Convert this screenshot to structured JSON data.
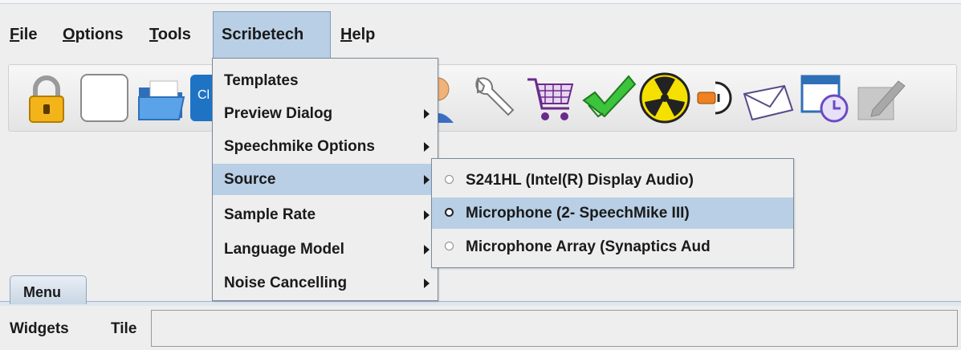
{
  "menubar": {
    "items": [
      {
        "label": "File",
        "mnemonic": "F",
        "rest": "ile"
      },
      {
        "label": "Options",
        "mnemonic": "O",
        "rest": "ptions"
      },
      {
        "label": "Tools",
        "mnemonic": "T",
        "rest": "ools"
      },
      {
        "label": "Scribetech"
      },
      {
        "label": "Help",
        "mnemonic": "H",
        "rest": "elp"
      }
    ]
  },
  "toolbar": {
    "icons": [
      "lock-icon",
      "blank-page-icon",
      "folder-icon",
      "partial-blue-icon",
      "user-icon",
      "wrench-icon",
      "shopping-cart-icon",
      "checkmark-icon",
      "radiation-icon",
      "plug-icon",
      "envelope-icon",
      "window-clock-icon",
      "disabled-edit-icon"
    ],
    "partial_label": "Cl"
  },
  "scribetech_menu": {
    "items": [
      {
        "label": "Templates",
        "submenu": false
      },
      {
        "label": "Preview Dialog",
        "submenu": true
      },
      {
        "label": "Speechmike Options",
        "submenu": true
      },
      {
        "label": "Source",
        "submenu": true,
        "highlighted": true
      },
      {
        "label": "Sample Rate",
        "submenu": true
      },
      {
        "label": "Language Model",
        "submenu": true
      },
      {
        "label": "Noise Cancelling",
        "submenu": true
      }
    ]
  },
  "source_submenu": {
    "items": [
      {
        "label": "S241HL (Intel(R) Display Audio)",
        "highlighted": false
      },
      {
        "label": "Microphone (2- SpeechMike III)",
        "highlighted": true
      },
      {
        "label": "Microphone Array (Synaptics Aud",
        "highlighted": false
      }
    ]
  },
  "tabs": {
    "menu_label": "Menu"
  },
  "bottombar": {
    "widgets_label": "Widgets",
    "tile_label": "Tile"
  },
  "colors": {
    "highlight": "#b8cfe5",
    "menu_bg": "#eeeeee",
    "border": "#7a8a9e"
  }
}
